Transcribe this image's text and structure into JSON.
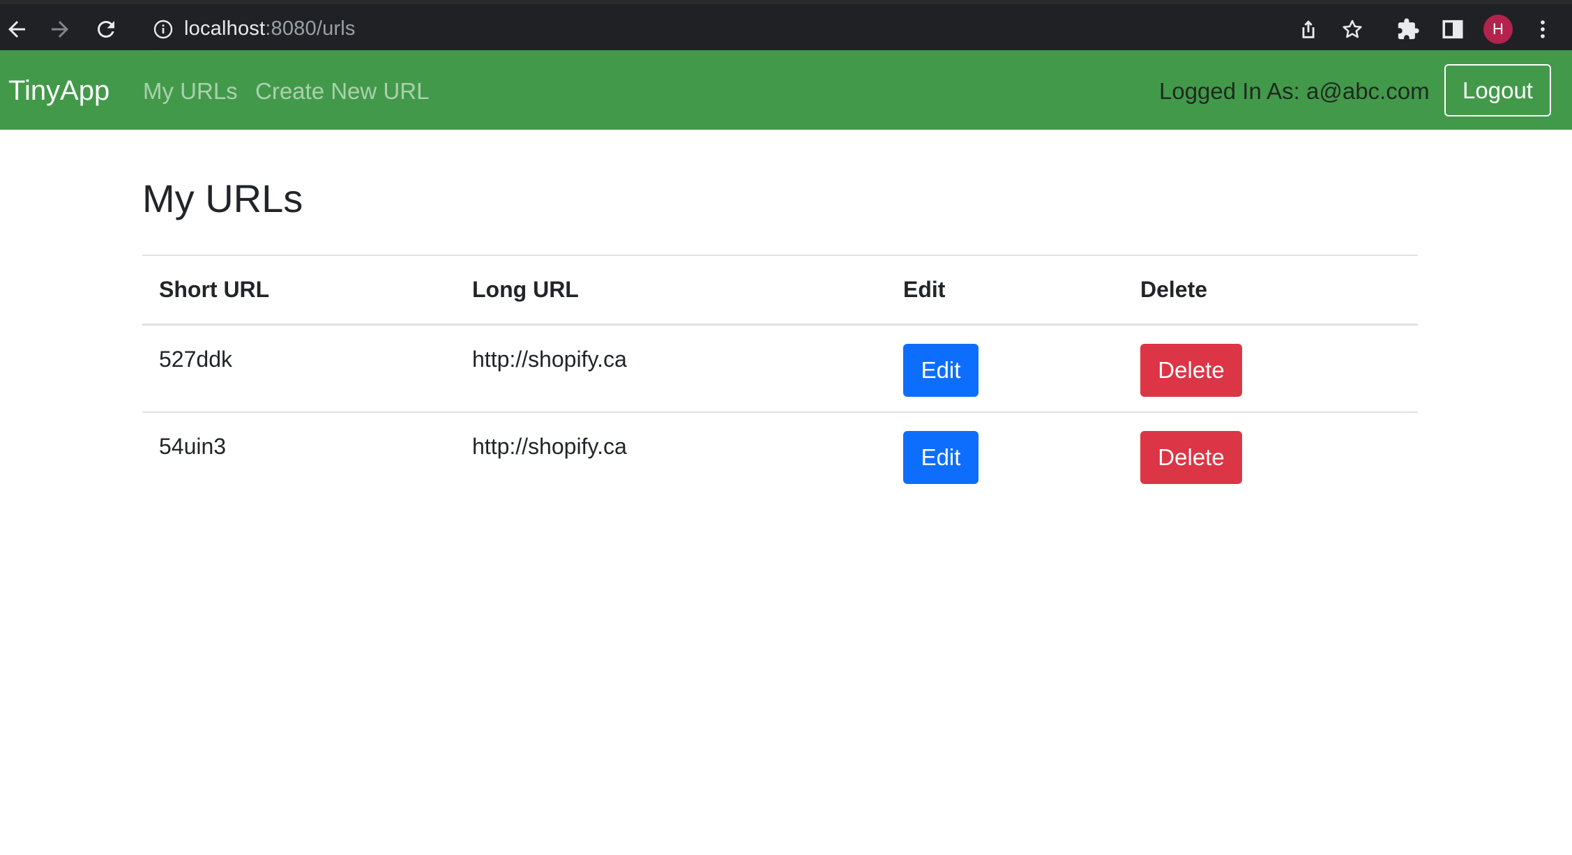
{
  "browser": {
    "url_host": "localhost",
    "url_path": ":8080/urls",
    "profile_initial": "H",
    "icons": [
      "back-arrow-icon",
      "forward-arrow-icon",
      "reload-icon",
      "info-icon",
      "share-icon",
      "star-icon",
      "extensions-icon",
      "side-panel-icon",
      "menu-dots-icon"
    ]
  },
  "navbar": {
    "brand": "TinyApp",
    "links": [
      {
        "label": "My URLs"
      },
      {
        "label": "Create New URL"
      }
    ],
    "logged_in_text": "Logged In As: a@abc.com",
    "logout_label": "Logout",
    "background_color": "#43994a"
  },
  "main": {
    "title": "My URLs",
    "table": {
      "headers": [
        "Short URL",
        "Long URL",
        "Edit",
        "Delete"
      ],
      "rows": [
        {
          "short_url": "527ddk",
          "long_url": "http://shopify.ca",
          "edit_label": "Edit",
          "delete_label": "Delete"
        },
        {
          "short_url": "54uin3",
          "long_url": "http://shopify.ca",
          "edit_label": "Edit",
          "delete_label": "Delete"
        }
      ]
    }
  },
  "colors": {
    "edit_button": "#0d6efd",
    "delete_button": "#dc3545"
  }
}
